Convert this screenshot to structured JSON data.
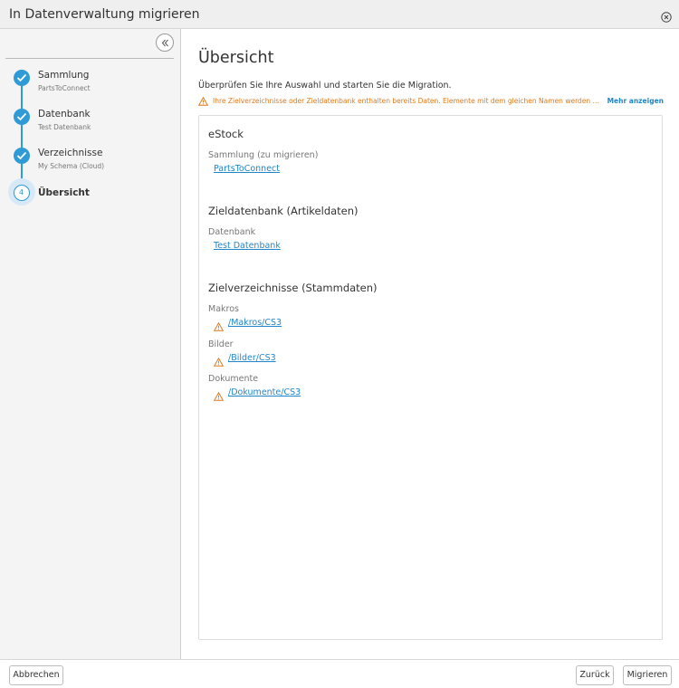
{
  "window": {
    "title": "In Datenverwaltung migrieren"
  },
  "sidebar": {
    "steps": [
      {
        "label": "Sammlung",
        "sub": "PartsToConnect",
        "state": "done"
      },
      {
        "label": "Datenbank",
        "sub": "Test Datenbank",
        "state": "done"
      },
      {
        "label": "Verzeichnisse",
        "sub": "My Schema (Cloud)",
        "state": "done"
      },
      {
        "label": "Übersicht",
        "number": "4",
        "state": "active"
      }
    ]
  },
  "main": {
    "title": "Übersicht",
    "intro": "Überprüfen Sie Ihre Auswahl und starten Sie die Migration.",
    "warning": "Ihre Zielverzeichnisse oder Zieldatenbank enthalten bereits Daten. Elemente mit dem gleichen Namen werden bei der Migration überschrieben.",
    "more_link": "Mehr anzeigen",
    "sections": {
      "estock": {
        "title": "eStock",
        "field_label": "Sammlung (zu migrieren)",
        "value": "PartsToConnect"
      },
      "target_db": {
        "title": "Zieldatenbank (Artikeldaten)",
        "field_label": "Datenbank",
        "value": "Test Datenbank"
      },
      "target_dirs": {
        "title": "Zielverzeichnisse (Stammdaten)",
        "items": [
          {
            "label": "Makros",
            "value": "/Makros/CS3"
          },
          {
            "label": "Bilder",
            "value": "/Bilder/CS3"
          },
          {
            "label": "Dokumente",
            "value": "/Dokumente/CS3"
          }
        ]
      }
    }
  },
  "footer": {
    "cancel_label": "Abbrechen",
    "back_label": "Zurück",
    "migrate_label": "Migrieren"
  },
  "colors": {
    "accent": "#2e9bd6",
    "link": "#1f86c9",
    "warning": "#e07a1c"
  }
}
